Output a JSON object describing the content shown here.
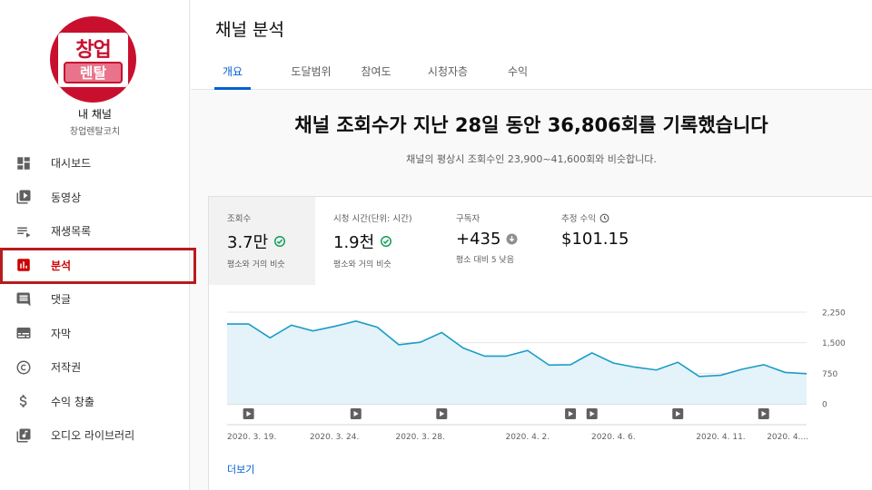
{
  "sidebar": {
    "avatar_line1": "창업",
    "avatar_line2": "렌탈",
    "my_channel": "내 채널",
    "channel_name": "창업렌탈코치",
    "items": [
      {
        "label": "대시보드",
        "icon": "dashboard-icon"
      },
      {
        "label": "동영상",
        "icon": "video-library-icon"
      },
      {
        "label": "재생목록",
        "icon": "playlist-icon"
      },
      {
        "label": "분석",
        "icon": "analytics-icon",
        "active": true
      },
      {
        "label": "댓글",
        "icon": "comment-icon"
      },
      {
        "label": "자막",
        "icon": "subtitles-icon"
      },
      {
        "label": "저작권",
        "icon": "copyright-icon"
      },
      {
        "label": "수익 창출",
        "icon": "dollar-icon"
      },
      {
        "label": "오디오 라이브러리",
        "icon": "audio-library-icon"
      }
    ]
  },
  "header": {
    "title": "채널 분석",
    "tabs": [
      "개요",
      "도달범위",
      "참여도",
      "시청자층",
      "수익"
    ],
    "active_tab": 0
  },
  "summary": {
    "headline": "채널 조회수가 지난 28일 동안 36,806회를 기록했습니다",
    "subline": "채널의 평상시 조회수인 23,900~41,600회와 비슷합니다."
  },
  "metrics": [
    {
      "label": "조회수",
      "value": "3.7만",
      "note": "평소와 거의 비슷",
      "status_icon": "check-circle-icon"
    },
    {
      "label": "시청 시간(단위: 시간)",
      "value": "1.9천",
      "note": "평소와 거의 비슷",
      "status_icon": "check-circle-icon"
    },
    {
      "label": "구독자",
      "value": "+435",
      "note": "평소 대비 5 낮음",
      "status_icon": "down-arrow-icon"
    },
    {
      "label": "추정 수익",
      "value": "$101.15",
      "note": "",
      "label_icon": "clock-icon"
    }
  ],
  "chart_data": {
    "type": "area",
    "x": [
      "2020. 3. 19.",
      "2020. 3. 20.",
      "2020. 3. 21.",
      "2020. 3. 22.",
      "2020. 3. 23.",
      "2020. 3. 24.",
      "2020. 3. 25.",
      "2020. 3. 26.",
      "2020. 3. 27.",
      "2020. 3. 28.",
      "2020. 3. 29.",
      "2020. 3. 30.",
      "2020. 3. 31.",
      "2020. 4. 1.",
      "2020. 4. 2.",
      "2020. 4. 3.",
      "2020. 4. 4.",
      "2020. 4. 5.",
      "2020. 4. 6.",
      "2020. 4. 7.",
      "2020. 4. 8.",
      "2020. 4. 9.",
      "2020. 4. 10.",
      "2020. 4. 11.",
      "2020. 4. 12.",
      "2020. 4. 13.",
      "2020. 4. 14.",
      "2020. 4. 15."
    ],
    "values": [
      1960,
      1960,
      1620,
      1930,
      1790,
      1900,
      2030,
      1880,
      1450,
      1510,
      1750,
      1370,
      1170,
      1170,
      1310,
      950,
      960,
      1250,
      1000,
      900,
      830,
      1020,
      670,
      700,
      850,
      960,
      770,
      740
    ],
    "ylim": [
      0,
      2250
    ],
    "yticks": [
      0,
      750,
      1500,
      2250
    ],
    "ytick_labels": [
      "0",
      "750",
      "1,500",
      "2,250"
    ],
    "xtick_labels": [
      {
        "index": 0,
        "label": "2020. 3. 19."
      },
      {
        "index": 5,
        "label": "2020. 3. 24."
      },
      {
        "index": 9,
        "label": "2020. 3. 28."
      },
      {
        "index": 14,
        "label": "2020. 4. 2."
      },
      {
        "index": 18,
        "label": "2020. 4. 6."
      },
      {
        "index": 23,
        "label": "2020. 4. 11."
      },
      {
        "index": 27,
        "label": "2020. 4...."
      }
    ],
    "video_markers": [
      1,
      6,
      10,
      16,
      17,
      21,
      25
    ],
    "line_color": "#1a9cc7",
    "fill_color": "#e3f3f9",
    "grid": true
  },
  "more_link": "더보기",
  "colors": {
    "accent": "#065fd4",
    "active": "#cc0000",
    "ok": "#0f9d58",
    "highlight_box": "#b71c1c"
  }
}
